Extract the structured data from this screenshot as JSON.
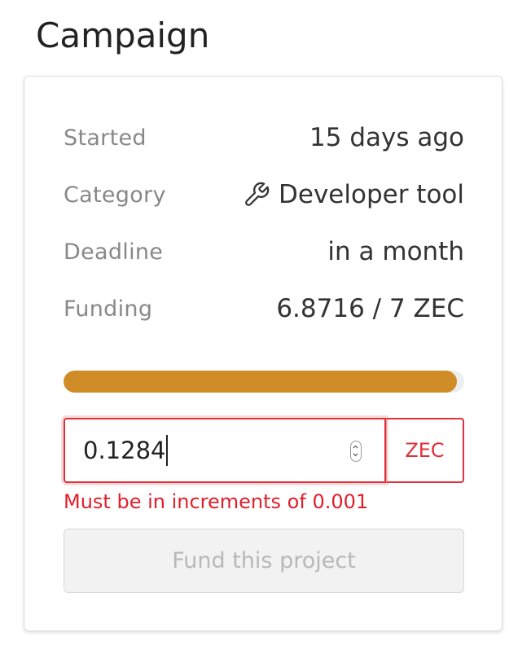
{
  "header": {
    "title": "Campaign"
  },
  "details": [
    {
      "label": "Started",
      "value": "15 days ago"
    },
    {
      "label": "Category",
      "value": "Developer tool",
      "icon": "wrench-icon"
    },
    {
      "label": "Deadline",
      "value": "in a month"
    },
    {
      "label": "Funding",
      "value": "6.8716 / 7 ZEC"
    }
  ],
  "progress": {
    "fraction": 0.9817,
    "color": "#d08c26"
  },
  "contribution": {
    "amount_value": "0.1284",
    "unit": "ZEC",
    "error": "Must be in increments of 0.001",
    "error_color": "#e0202c"
  },
  "actions": {
    "fund_label": "Fund this project"
  }
}
